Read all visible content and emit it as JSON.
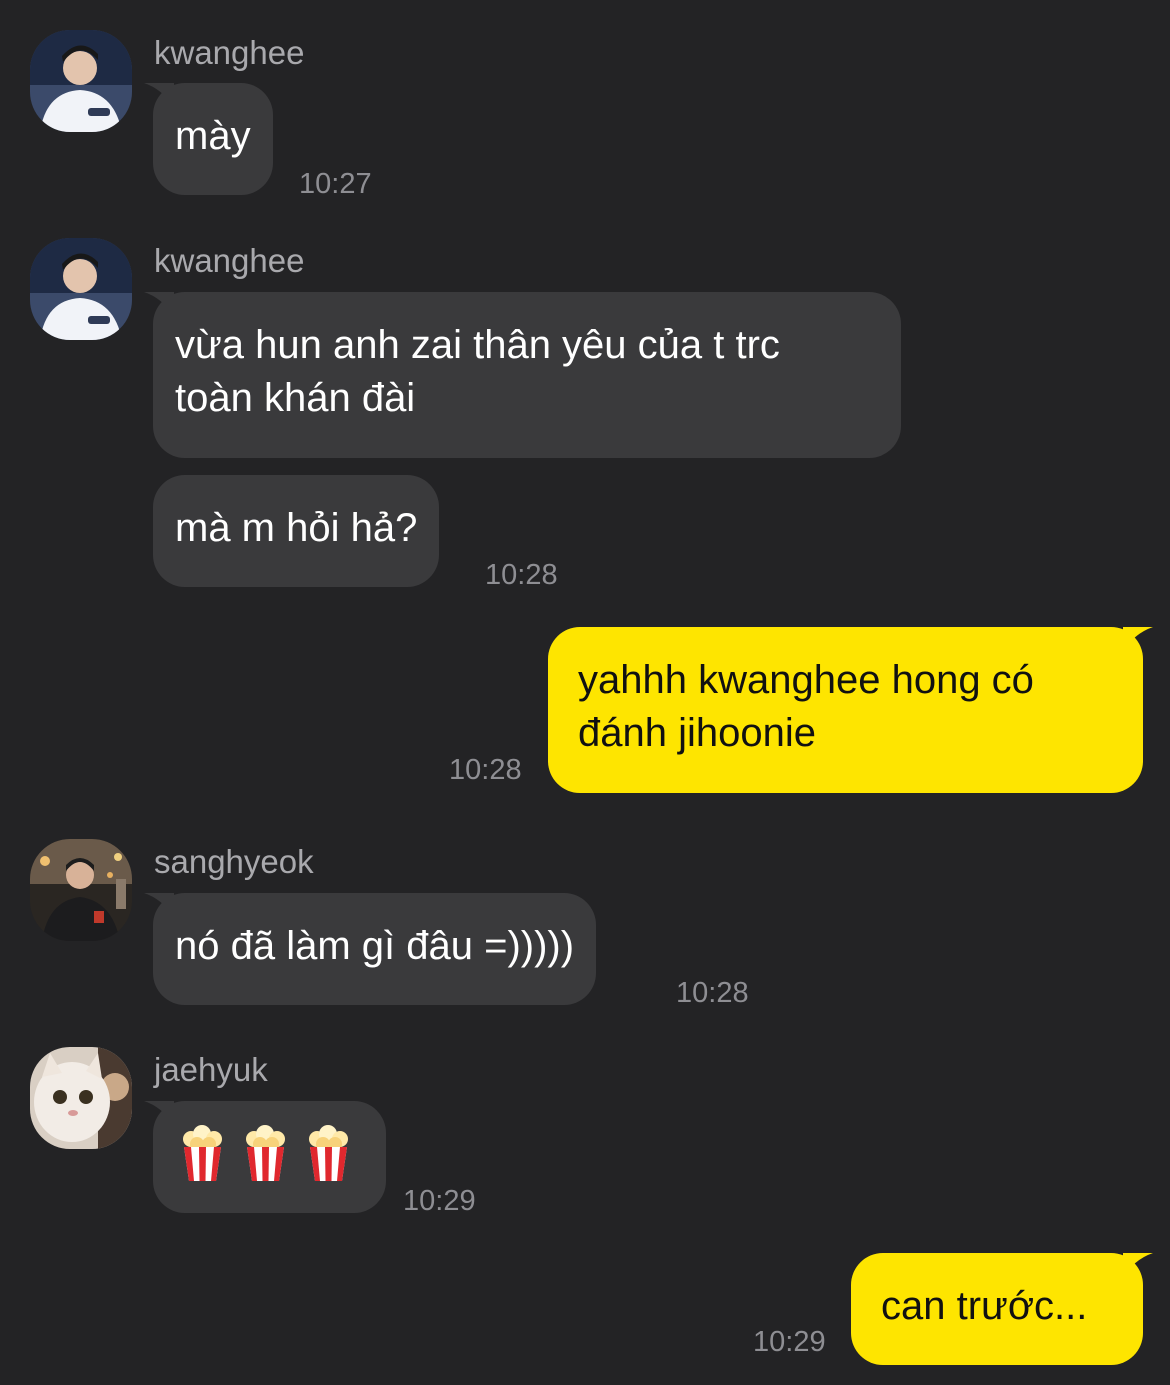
{
  "messages": [
    {
      "sender": "kwanghee",
      "text": "mày",
      "time": "10:27"
    },
    {
      "sender": "kwanghee",
      "lines": [
        "vừa hun anh zai thân yêu của t trc",
        "toàn khán đài"
      ]
    },
    {
      "text": "mà m hỏi hả?",
      "time": "10:28"
    },
    {
      "lines": [
        "yahhh kwanghee hong có",
        "đánh jihoonie"
      ],
      "time": "10:28"
    },
    {
      "sender": "sanghyeok",
      "text": "nó đã làm gì đâu =)))))",
      "time": "10:28"
    },
    {
      "sender": "jaehyuk",
      "emojis": [
        "popcorn-emoji",
        "popcorn-emoji",
        "popcorn-emoji"
      ],
      "time": "10:29"
    },
    {
      "text": "can trước...",
      "time": "10:29"
    }
  ],
  "colors": {
    "background": "#232325",
    "incoming_bubble": "#3a3a3c",
    "outgoing_bubble": "#fee500",
    "incoming_text": "#ffffff",
    "outgoing_text": "#111111",
    "sender_name": "#a9a9ad",
    "timestamp": "#8e8e93"
  }
}
